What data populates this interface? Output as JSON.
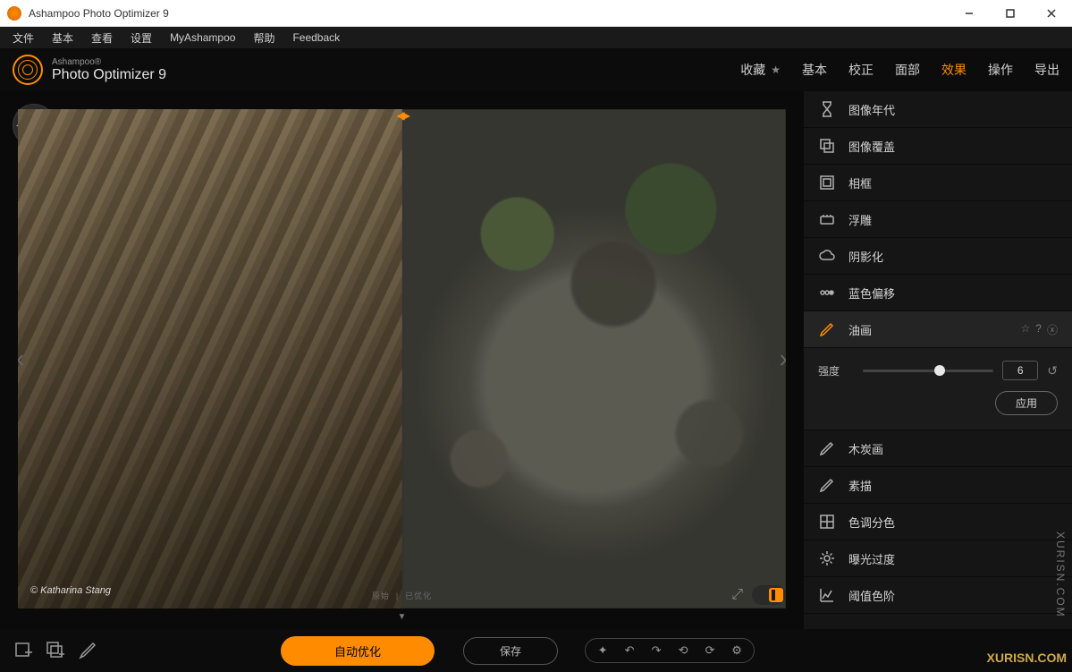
{
  "titlebar": {
    "title": "Ashampoo Photo Optimizer 9"
  },
  "menubar": [
    "文件",
    "基本",
    "查看",
    "设置",
    "MyAshampoo",
    "帮助",
    "Feedback"
  ],
  "logo": {
    "brand": "Ashampoo®",
    "product": "Photo Optimizer 9"
  },
  "tabs": [
    {
      "label": "收藏",
      "star": true,
      "active": false
    },
    {
      "label": "基本",
      "active": false
    },
    {
      "label": "校正",
      "active": false
    },
    {
      "label": "面部",
      "active": false
    },
    {
      "label": "效果",
      "active": true
    },
    {
      "label": "操作",
      "active": false
    },
    {
      "label": "导出",
      "active": false
    }
  ],
  "viewer": {
    "credit": "© Katharina Stang",
    "split_left_label": "原始",
    "split_right_label": "已优化"
  },
  "effects": [
    {
      "icon": "hourglass",
      "label": "图像年代"
    },
    {
      "icon": "overlay",
      "label": "图像覆盖"
    },
    {
      "icon": "frame",
      "label": "相框"
    },
    {
      "icon": "emboss",
      "label": "浮雕"
    },
    {
      "icon": "cloud",
      "label": "阴影化"
    },
    {
      "icon": "dots",
      "label": "蓝色偏移"
    },
    {
      "icon": "brush",
      "label": "油画",
      "active": true
    },
    {
      "icon": "pencil",
      "label": "木炭画"
    },
    {
      "icon": "pencil",
      "label": "素描"
    },
    {
      "icon": "levels",
      "label": "色调分色"
    },
    {
      "icon": "gear",
      "label": "曝光过度"
    },
    {
      "icon": "chart",
      "label": "阈值色阶"
    }
  ],
  "params": {
    "strength_label": "强度",
    "strength_value": "6",
    "apply_label": "应用"
  },
  "bottom": {
    "auto_optimize": "自动优化",
    "save": "保存"
  },
  "watermark_vertical": "XURISN.COM",
  "watermark_horizontal": "XURISN.COM"
}
